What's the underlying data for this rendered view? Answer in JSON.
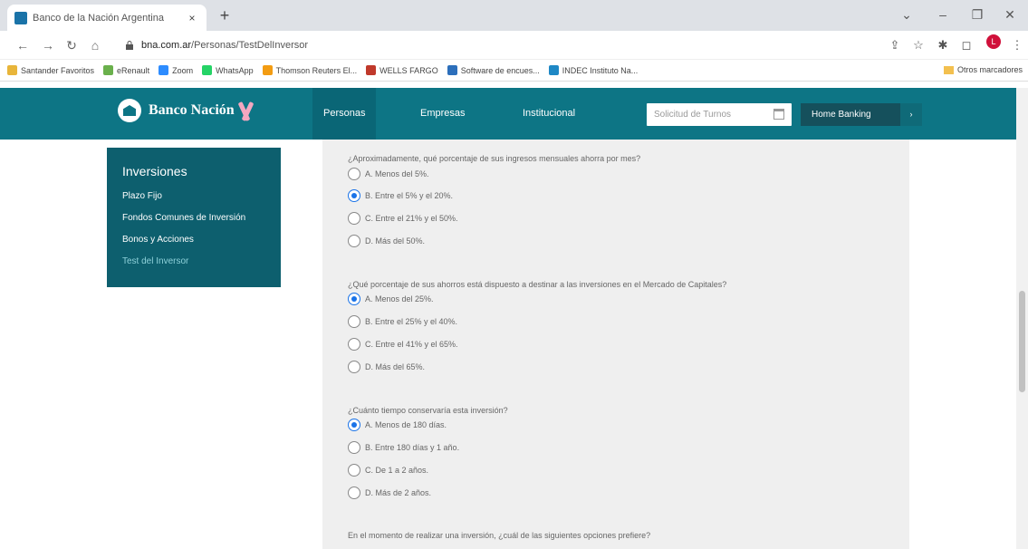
{
  "browser": {
    "tab_title": "Banco de la Nación Argentina",
    "tab_close": "×",
    "new_tab": "+",
    "url_host": "bna.com.ar",
    "url_path": "/Personas/TestDelInversor",
    "bookmarks": [
      {
        "label": "Santander Favoritos",
        "color": "#e8b53a"
      },
      {
        "label": "eRenault",
        "color": "#6ab04c"
      },
      {
        "label": "Zoom",
        "color": "#2d8cff"
      },
      {
        "label": "WhatsApp",
        "color": "#25d366"
      },
      {
        "label": "Thomson Reuters El...",
        "color": "#f39c12"
      },
      {
        "label": "WELLS FARGO",
        "color": "#c0392b"
      },
      {
        "label": "Software de encues...",
        "color": "#2c6fbb"
      },
      {
        "label": "INDEC Instituto Na...",
        "color": "#1e88c5"
      }
    ],
    "other_bookmarks": "Otros marcadores",
    "profile_initial": "L"
  },
  "header": {
    "brand": "Banco Nación",
    "nav": [
      "Personas",
      "Empresas",
      "Institucional"
    ],
    "turnos_placeholder": "Solicitud de Turnos",
    "home_banking": "Home Banking"
  },
  "sidebar": {
    "title": "Inversiones",
    "links": [
      "Plazo Fijo",
      "Fondos Comunes de Inversión",
      "Bonos y Acciones",
      "Test del Inversor"
    ]
  },
  "quiz": {
    "q1": {
      "text": "¿Aproximadamente, qué porcentaje de sus ingresos mensuales ahorra por mes?",
      "options": [
        "A. Menos del 5%.",
        "B. Entre el 5% y el 20%.",
        "C. Entre el 21% y el 50%.",
        "D. Más del 50%."
      ],
      "selected": 1
    },
    "q2": {
      "text": "¿Qué porcentaje de sus ahorros está dispuesto a destinar a las inversiones en el Mercado de Capitales?",
      "options": [
        "A. Menos del 25%.",
        "B. Entre el 25% y el 40%.",
        "C. Entre el 41% y el 65%.",
        "D. Más del 65%."
      ],
      "selected": 0
    },
    "q3": {
      "text": "¿Cuánto tiempo conservaría esta inversión?",
      "options": [
        "A. Menos de 180 días.",
        "B. Entre 180 días y 1 año.",
        "C. De 1 a 2 años.",
        "D. Más de 2 años."
      ],
      "selected": 0
    },
    "q4": {
      "text": "En el momento de realizar una inversión, ¿cuál de las siguientes opciones prefiere?"
    }
  }
}
